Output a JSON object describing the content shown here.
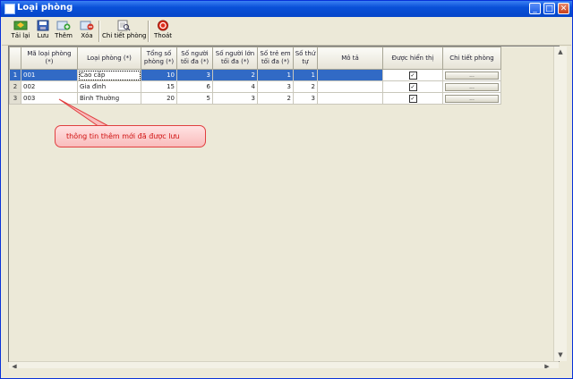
{
  "window": {
    "title": "Loại phòng"
  },
  "toolbar": [
    {
      "label": "Tải lại",
      "icon": "refresh-icon"
    },
    {
      "label": "Lưu",
      "icon": "save-icon"
    },
    {
      "label": "Thêm",
      "icon": "add-icon"
    },
    {
      "label": "Xóa",
      "icon": "delete-icon"
    },
    {
      "label": "Chi tiết phòng",
      "icon": "detail-icon"
    },
    {
      "label": "Thoát",
      "icon": "exit-icon"
    }
  ],
  "grid": {
    "columns": [
      "Mã loại phòng (*)",
      "Loại phòng (*)",
      "Tổng số phòng (*)",
      "Số người tối đa (*)",
      "Số người lớn tối đa (*)",
      "Số trẻ em tối đa (*)",
      "Số thứ tự",
      "Mô tả",
      "Được hiển thị",
      "Chi tiết phòng"
    ],
    "rows": [
      {
        "num": "1",
        "code": "001",
        "type": "Cao cấp",
        "total": "10",
        "max_people": "3",
        "max_adults": "2",
        "max_children": "1",
        "order": "1",
        "desc": "",
        "visible": true,
        "detail_button": "..."
      },
      {
        "num": "2",
        "code": "002",
        "type": "Gia đình",
        "total": "15",
        "max_people": "6",
        "max_adults": "4",
        "max_children": "3",
        "order": "2",
        "desc": "",
        "visible": true,
        "detail_button": "..."
      },
      {
        "num": "3",
        "code": "003",
        "type": "Bình Thường",
        "total": "20",
        "max_people": "5",
        "max_adults": "3",
        "max_children": "2",
        "order": "3",
        "desc": "",
        "visible": true,
        "detail_button": "..."
      }
    ],
    "selected_row": 1
  },
  "callout": {
    "text": "thông tin thêm mới đã được lưu"
  },
  "colors": {
    "title_bar": "#0a50d8",
    "selection": "#316ac5",
    "callout_text": "#d01010",
    "callout_fill": "#f9bcbc"
  }
}
